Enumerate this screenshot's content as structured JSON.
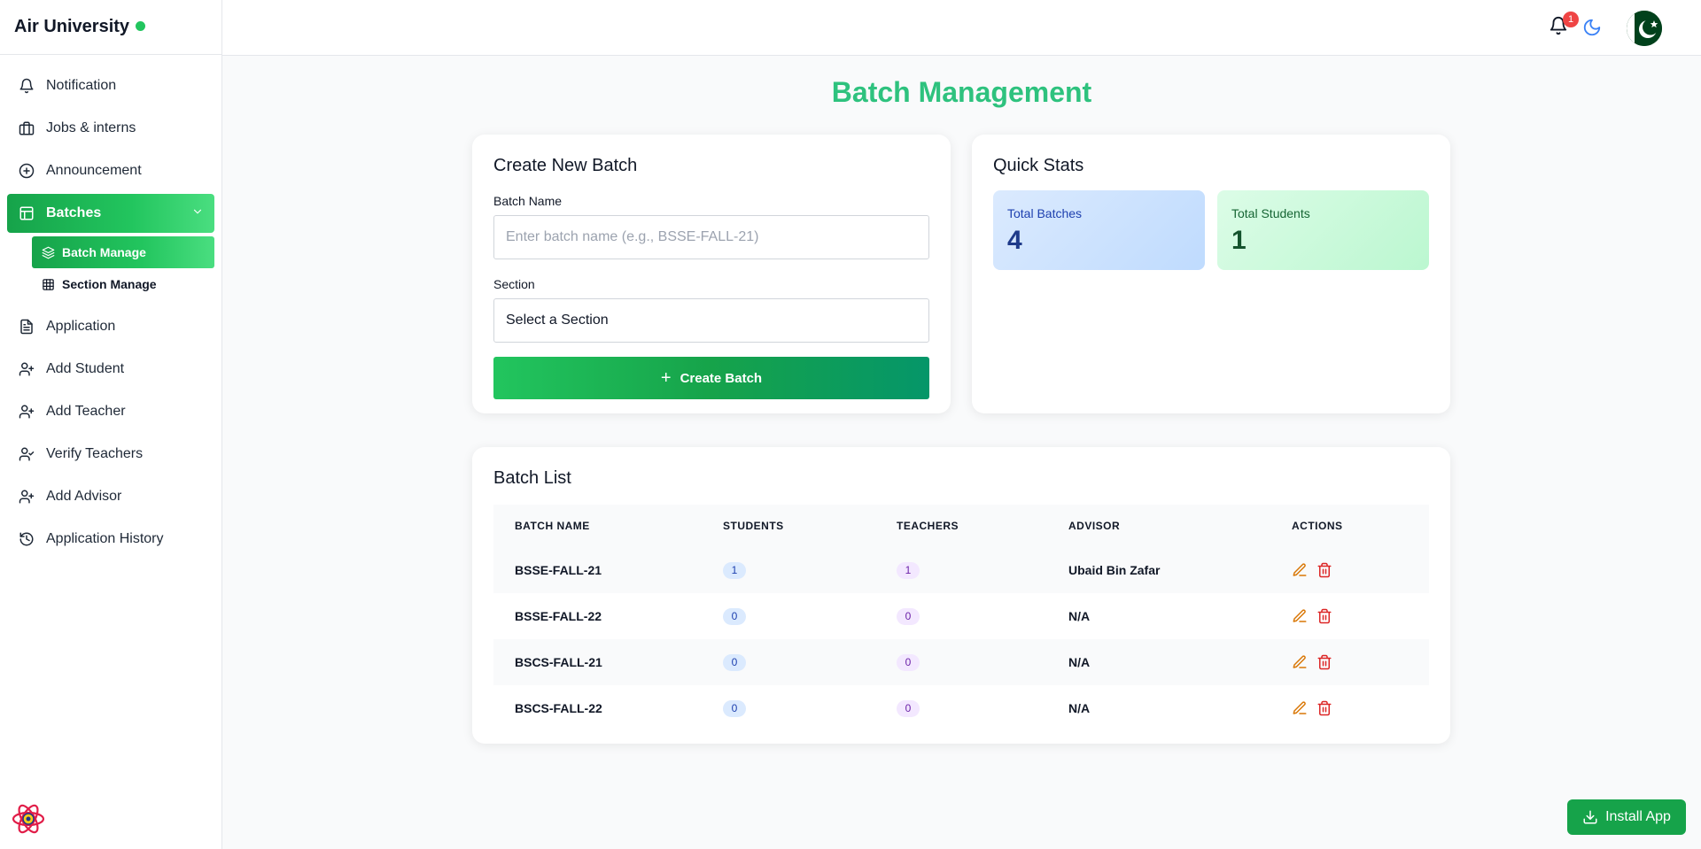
{
  "app": {
    "title": "Air University"
  },
  "sidebar": {
    "items": [
      {
        "label": "Notification",
        "icon": "bell-icon"
      },
      {
        "label": "Jobs & interns",
        "icon": "briefcase-icon"
      },
      {
        "label": "Announcement",
        "icon": "plus-circle-icon"
      },
      {
        "label": "Batches",
        "icon": "layout-icon"
      },
      {
        "label": "Application",
        "icon": "file-text-icon"
      },
      {
        "label": "Add Student",
        "icon": "user-plus-icon"
      },
      {
        "label": "Add Teacher",
        "icon": "user-plus-icon"
      },
      {
        "label": "Verify Teachers",
        "icon": "user-check-icon"
      },
      {
        "label": "Add Advisor",
        "icon": "user-plus-icon"
      },
      {
        "label": "Application History",
        "icon": "history-icon"
      }
    ],
    "batches_sub": [
      {
        "label": "Batch Manage",
        "icon": "layers-icon"
      },
      {
        "label": "Section Manage",
        "icon": "grid-icon"
      }
    ]
  },
  "topbar": {
    "notification_count": "1"
  },
  "page": {
    "title": "Batch Management"
  },
  "create_batch": {
    "title": "Create New Batch",
    "batch_name_label": "Batch Name",
    "batch_name_placeholder": "Enter batch name (e.g., BSSE-FALL-21)",
    "section_label": "Section",
    "section_value": "Select a Section",
    "button_label": "Create Batch"
  },
  "quick_stats": {
    "title": "Quick Stats",
    "total_batches_label": "Total Batches",
    "total_batches_value": "4",
    "total_students_label": "Total Students",
    "total_students_value": "1"
  },
  "batch_list": {
    "title": "Batch List",
    "columns": [
      "BATCH NAME",
      "STUDENTS",
      "TEACHERS",
      "ADVISOR",
      "ACTIONS"
    ],
    "rows": [
      {
        "name": "BSSE-FALL-21",
        "students": "1",
        "teachers": "1",
        "advisor": "Ubaid Bin Zafar"
      },
      {
        "name": "BSSE-FALL-22",
        "students": "0",
        "teachers": "0",
        "advisor": "N/A"
      },
      {
        "name": "BSCS-FALL-21",
        "students": "0",
        "teachers": "0",
        "advisor": "N/A"
      },
      {
        "name": "BSCS-FALL-22",
        "students": "0",
        "teachers": "0",
        "advisor": "N/A"
      }
    ]
  },
  "install": {
    "label": "Install App"
  },
  "colors": {
    "accent": "#22c55e",
    "title": "#2ec27e",
    "edit": "#d97706",
    "delete": "#dc2626"
  }
}
